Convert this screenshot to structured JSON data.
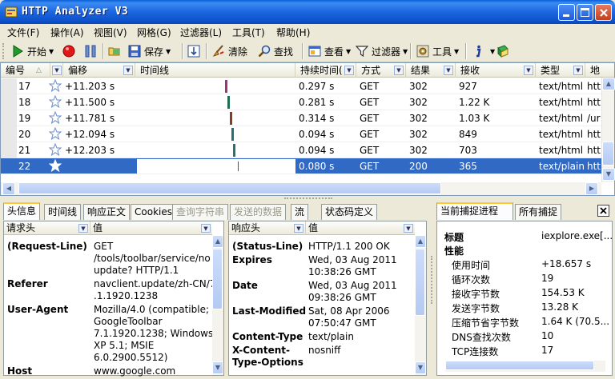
{
  "app": {
    "title": "HTTP Analyzer V3"
  },
  "menu": [
    "文件(F)",
    "操作(A)",
    "视图(V)",
    "网格(G)",
    "过滤器(L)",
    "工具(T)",
    "帮助(H)"
  ],
  "toolbar": {
    "start": "开始",
    "save": "保存",
    "clear": "清除",
    "find": "查找",
    "view": "查看",
    "filter": "过滤器",
    "tools": "工具"
  },
  "grid": {
    "columns": [
      "编号",
      "偏移",
      "时间线",
      "持续时间(",
      "方式",
      "结果",
      "接收",
      "类型",
      "地"
    ],
    "rows": [
      {
        "id": "17",
        "offset": "+11.203 s",
        "duration": "0.297 s",
        "method": "GET",
        "result": "302",
        "received": "927",
        "type": "text/html",
        "addr": "htt",
        "bar_color": "#a2307a"
      },
      {
        "id": "18",
        "offset": "+11.500 s",
        "duration": "0.281 s",
        "method": "GET",
        "result": "302",
        "received": "1.22 K",
        "type": "text/html",
        "addr": "htt",
        "bar_color": "#1f6e54"
      },
      {
        "id": "19",
        "offset": "+11.781 s",
        "duration": "0.314 s",
        "method": "GET",
        "result": "302",
        "received": "1.03 K",
        "type": "text/html",
        "addr": "/ur",
        "bar_color": "#8a3b26"
      },
      {
        "id": "20",
        "offset": "+12.094 s",
        "duration": "0.094 s",
        "method": "GET",
        "result": "302",
        "received": "849",
        "type": "text/html",
        "addr": "htt",
        "bar_color": "#2b6f74"
      },
      {
        "id": "21",
        "offset": "+12.203 s",
        "duration": "0.094 s",
        "method": "GET",
        "result": "302",
        "received": "703",
        "type": "text/html",
        "addr": "htt",
        "bar_color": "#2b6f74"
      },
      {
        "id": "22",
        "offset": "",
        "duration": "0.080 s",
        "method": "GET",
        "result": "200",
        "received": "365",
        "type": "text/plain",
        "addr": "htt",
        "bar_color": "#1f6e54",
        "selected": true
      }
    ]
  },
  "left_tabs": [
    "头信息",
    "时间线",
    "响应正文",
    "Cookies",
    "查询字符串",
    "发送的数据",
    "流",
    "状态码定义"
  ],
  "request": {
    "header_key": "请求头",
    "header_val": "值",
    "items": [
      {
        "k": "(Request-Line)",
        "v": [
          "GET",
          "/tools/toolbar/service/no",
          "update? HTTP/1.1"
        ]
      },
      {
        "k": "Referer",
        "v": [
          "navclient.update/zh-CN/7",
          ".1.1920.1238"
        ]
      },
      {
        "k": "User-Agent",
        "v": [
          "Mozilla/4.0 (compatible;",
          "GoogleToolbar",
          "7.1.1920.1238; Windows",
          "XP 5.1; MSIE",
          "6.0.2900.5512)"
        ]
      },
      {
        "k": "Host",
        "v": [
          "www.google.com"
        ]
      }
    ]
  },
  "response": {
    "header_key": "响应头",
    "header_val": "值",
    "items": [
      {
        "k": "(Status-Line)",
        "v": [
          "HTTP/1.1 200 OK"
        ]
      },
      {
        "k": "Expires",
        "v": [
          "Wed, 03 Aug 2011",
          "10:38:26 GMT"
        ]
      },
      {
        "k": "Date",
        "v": [
          "Wed, 03 Aug 2011",
          "09:38:26 GMT"
        ]
      },
      {
        "k": "Last-Modified",
        "v": [
          "Sat, 08 Apr 2006",
          "07:50:47 GMT"
        ]
      },
      {
        "k": "Content-Type",
        "v": [
          "text/plain"
        ]
      },
      {
        "k": "X-Content-Type-Options",
        "v": [
          "nosniff"
        ]
      }
    ]
  },
  "right_tabs": [
    "当前捕捉进程",
    "所有捕捉"
  ],
  "session": {
    "title_label": "标题",
    "title_value": "iexplore.exe[...",
    "perf_label": "性能",
    "stats": [
      {
        "k": "使用时间",
        "v": "+18.657 s"
      },
      {
        "k": "循环次数",
        "v": "19"
      },
      {
        "k": "接收字节数",
        "v": "154.53 K"
      },
      {
        "k": "发送字节数",
        "v": "13.28 K"
      },
      {
        "k": "压缩节省字节数",
        "v": "1.64 K (70.5..."
      },
      {
        "k": "DNS查找次数",
        "v": "10"
      },
      {
        "k": "TCP连接数",
        "v": "17"
      }
    ]
  }
}
